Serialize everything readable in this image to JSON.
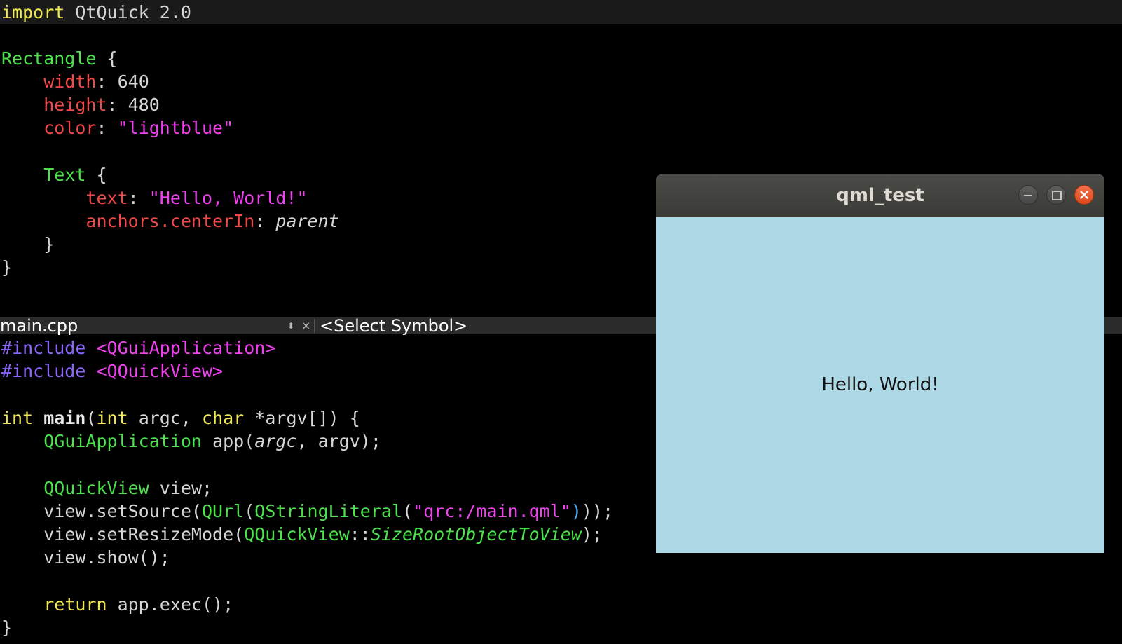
{
  "qml_code": {
    "import_kw": "import",
    "import_mod": "QtQuick 2.0",
    "rect_type": "Rectangle",
    "open_brace": "{",
    "width_prop": "width",
    "width_val": ": 640",
    "height_prop": "height",
    "height_val": ": 480",
    "color_prop": "color",
    "color_sep": ": ",
    "color_val": "\"lightblue\"",
    "text_type": "Text",
    "text_prop": "text",
    "text_sep": ": ",
    "text_val": "\"Hello, World!\"",
    "anchors_prop": "anchors.centerIn",
    "anchors_sep": ": ",
    "anchors_val": "parent",
    "close_inner": "}",
    "close_outer": "}"
  },
  "split_bar": {
    "file_name": "main.cpp",
    "arrows": "⬍",
    "close": "×",
    "symbol": "<Select Symbol>"
  },
  "cpp_code": {
    "include1_kw": "#include",
    "include1_val": "<QGuiApplication>",
    "include2_kw": "#include",
    "include2_val": "<QQuickView>",
    "main_int": "int",
    "main_name": "main",
    "main_paren": "(",
    "main_int2": "int",
    "main_argc": " argc, ",
    "main_char": "char",
    "main_rest": " *argv[]) {",
    "app_type": "QGuiApplication",
    "app_call": " app(",
    "app_argc": "argc",
    "app_rest": ", argv);",
    "view_type": "QQuickView",
    "view_decl": " view;",
    "setsrc_call": "view.setSource(",
    "qurl": "QUrl",
    "p1": "(",
    "qsl": "QStringLiteral",
    "p2": "(",
    "qrc_str": "\"qrc:/main.qml\"",
    "p3": ")",
    "p4": "));",
    "resize_call": "view.setResizeMode(",
    "resize_type": "QQuickView",
    "resize_scope": "::",
    "resize_enum": "SizeRootObjectToView",
    "resize_end": ");",
    "show_call": "view.show();",
    "return_kw": "return",
    "return_rest": " app.exec();",
    "close_brace": "}"
  },
  "window": {
    "title": "qml_test",
    "content_text": "Hello, World!",
    "background_color": "#add8e6"
  }
}
